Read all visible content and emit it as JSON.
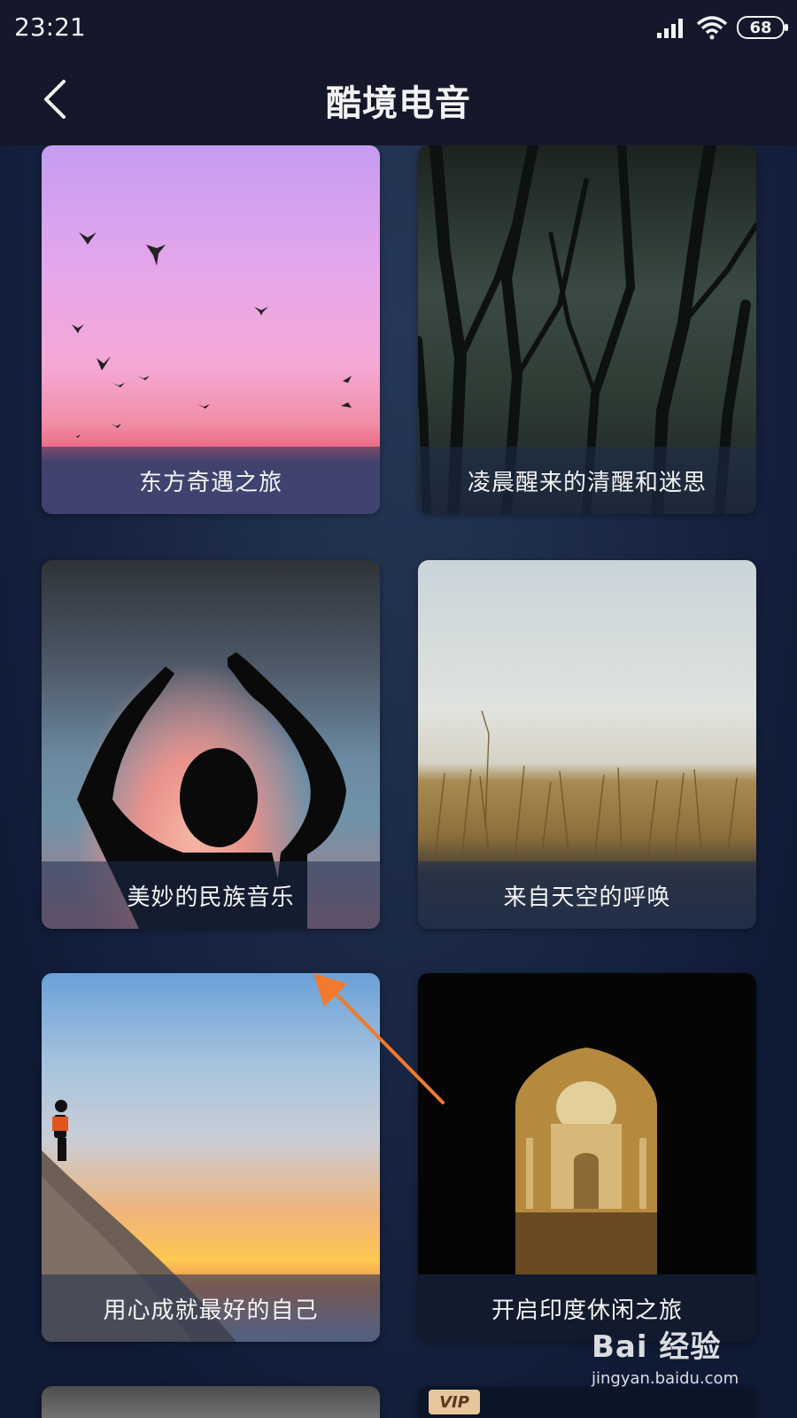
{
  "status_bar": {
    "time": "23:21",
    "battery": "68",
    "icons": [
      "signal-icon",
      "wifi-icon",
      "battery-icon"
    ]
  },
  "header": {
    "title": "酷境电音",
    "back_icon": "chevron-left-icon"
  },
  "cards": [
    {
      "caption": "东方奇遇之旅"
    },
    {
      "caption": "凌晨醒来的清醒和迷思"
    },
    {
      "caption": "美妙的民族音乐"
    },
    {
      "caption": "来自天空的呼唤"
    },
    {
      "caption": "用心成就最好的自己"
    },
    {
      "caption": "开启印度休闲之旅"
    }
  ],
  "partial_cards": [
    {
      "badge": ""
    },
    {
      "badge": "VIP"
    }
  ],
  "watermark": {
    "logo": "Bai 经验",
    "url": "jingyan.baidu.com"
  },
  "colors": {
    "background": "#0f1a35",
    "header": "#15172a",
    "annotation_arrow": "#f07a2e",
    "vip": "#e6c69a"
  }
}
